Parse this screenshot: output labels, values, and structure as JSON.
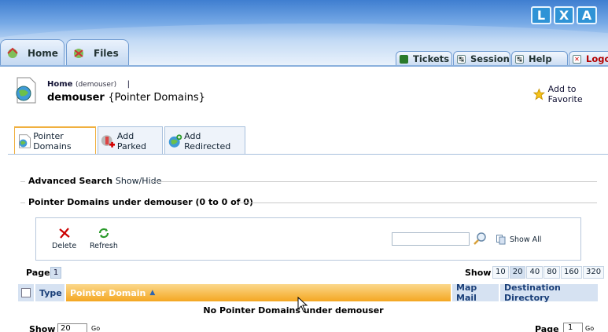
{
  "brand": {
    "logo_letters": [
      "L",
      "X",
      "A"
    ],
    "logo_color": "#2f93d6"
  },
  "nav": {
    "left_tabs": [
      {
        "label": "Home",
        "icon": "home-icon"
      },
      {
        "label": "Files",
        "icon": "files-icon"
      }
    ],
    "right_tabs": [
      {
        "label": "Tickets",
        "icon": "tickets-icon"
      },
      {
        "label": "Session",
        "icon": "session-icon"
      },
      {
        "label": "Help",
        "icon": "help-icon"
      },
      {
        "label": "Logo",
        "icon": "logout-icon"
      }
    ]
  },
  "breadcrumb": {
    "home": "Home",
    "user": "(demouser)",
    "separator": "|"
  },
  "title": {
    "user": "demouser",
    "section": "{Pointer Domains}"
  },
  "favorites": {
    "label": "Add to Favorite"
  },
  "subtabs": [
    {
      "label": "Pointer Domains",
      "active": true
    },
    {
      "label": "Add Parked",
      "active": false
    },
    {
      "label": "Add Redirected",
      "active": false
    }
  ],
  "advanced_search": {
    "label": "Advanced Search",
    "toggle": "Show/Hide"
  },
  "list_title": "Pointer Domains under demouser (0 to 0 of 0)",
  "toolbar": {
    "delete_label": "Delete",
    "refresh_label": "Refresh",
    "search_value": "",
    "show_all_label": "Show All"
  },
  "pager": {
    "page_label": "Page",
    "current_page": "1",
    "show_label": "Show",
    "show_options": [
      "10",
      "20",
      "40",
      "80",
      "160",
      "320"
    ],
    "selected_show": "20"
  },
  "table": {
    "columns": [
      "Type",
      "Pointer Domain",
      "Map Mail",
      "Destination Directory"
    ],
    "sorted_column": "Pointer Domain",
    "empty_message": "No Pointer Domains under demouser"
  },
  "bottom": {
    "show_label": "Show",
    "show_value": "20",
    "go_label": "Go",
    "page_label": "Page",
    "page_value": "1",
    "go2_label": "Go"
  },
  "colors": {
    "accent": "#f4a722",
    "header_blue": "#3f7ed0",
    "table_header": "#d6e2f2",
    "logout_red": "#b40000"
  }
}
